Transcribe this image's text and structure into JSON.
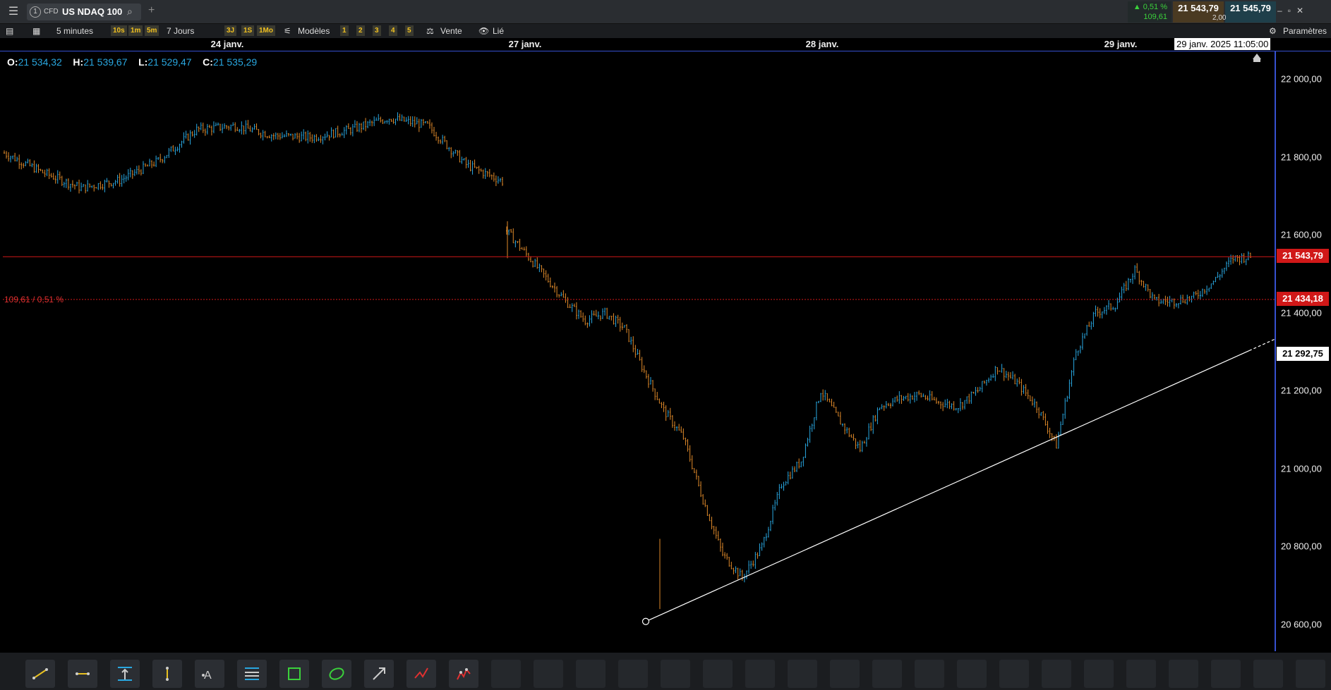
{
  "header": {
    "tab_number": "1",
    "tab_type": "CFD",
    "instrument": "US NDAQ 100",
    "change_pct": "▲ 0,51 %",
    "change_abs": "109,61",
    "bid": "21 543,79",
    "ask": "21 545,79",
    "spread": "2,00"
  },
  "toolbar": {
    "interval": "5 minutes",
    "quick_intervals": [
      "10s",
      "1m",
      "5m"
    ],
    "range": "7 Jours",
    "quick_ranges": [
      "3J",
      "1S",
      "1Mo"
    ],
    "templates": "Modèles",
    "layouts": [
      "1",
      "2",
      "3",
      "4",
      "5"
    ],
    "side": "Vente",
    "linked": "Lié",
    "settings": "Paramètres"
  },
  "ohlc": {
    "o_label": "O:",
    "o": "21 534,32",
    "h_label": "H:",
    "h": "21 539,67",
    "l_label": "L:",
    "l": "21 529,47",
    "c_label": "C:",
    "c": "21 535,29"
  },
  "date_labels": [
    "24 janv.",
    "27 janv.",
    "28 janv.",
    "29 janv."
  ],
  "cursor_date": "29 janv. 2025 11:05:00",
  "reference_label": "109,61 / 0,51 %",
  "price_ticks": [
    "22 000,00",
    "21 800,00",
    "21 600,00",
    "21 400,00",
    "21 200,00",
    "21 000,00",
    "20 800,00",
    "20 600,00"
  ],
  "price_tags": {
    "last": "21 543,79",
    "reference": "21 434,18",
    "trendline": "21 292,75"
  },
  "colors": {
    "up": "#29a7e0",
    "down": "#e08a2a",
    "last_line": "#d01818",
    "axis": "#3650d0"
  },
  "drawing_tools": [
    "trendline-icon",
    "horizontal-line-icon",
    "price-range-icon",
    "vertical-line-icon",
    "text-icon",
    "fibonacci-icon",
    "rectangle-icon",
    "ellipse-icon",
    "arrow-icon",
    "polyline-icon",
    "pattern-icon"
  ],
  "chart_data": {
    "type": "line",
    "title": "US NDAQ 100",
    "timeframe": "5 minutes",
    "x": [
      "24 janv.",
      "24 janv.",
      "24 janv.",
      "24 janv.",
      "24 janv.",
      "24 janv.",
      "24 janv.",
      "24 janv.",
      "24 janv.",
      "24 janv.",
      "24 janv.",
      "24 janv.",
      "24 janv.",
      "24 janv.",
      "27 janv.",
      "27 janv.",
      "27 janv.",
      "27 janv.",
      "27 janv.",
      "27 janv.",
      "27 janv.",
      "27 janv.",
      "27 janv.",
      "27 janv.",
      "27 janv.",
      "27 janv.",
      "27 janv.",
      "27 janv.",
      "27 janv.",
      "27 janv.",
      "28 janv.",
      "28 janv.",
      "28 janv.",
      "28 janv.",
      "28 janv.",
      "28 janv.",
      "28 janv.",
      "28 janv.",
      "28 janv.",
      "28 janv.",
      "28 janv.",
      "28 janv.",
      "28 janv.",
      "28 janv.",
      "28 janv.",
      "28 janv.",
      "29 janv.",
      "29 janv.",
      "29 janv.",
      "29 janv.",
      "29 janv.",
      "29 janv.",
      "29 janv."
    ],
    "close": [
      21810,
      21760,
      21720,
      21740,
      21790,
      21870,
      21880,
      21855,
      21850,
      21870,
      21900,
      21880,
      21780,
      21735,
      21610,
      21550,
      21490,
      21430,
      21380,
      21400,
      21360,
      21250,
      21150,
      21080,
      20920,
      20780,
      20720,
      20800,
      20960,
      21020,
      21200,
      21120,
      21050,
      21160,
      21180,
      21190,
      21170,
      21160,
      21200,
      21260,
      21220,
      21160,
      21060,
      21300,
      21400,
      21420,
      21510,
      21430,
      21430,
      21440,
      21480,
      21540,
      21544
    ],
    "ylim": [
      20540,
      22060
    ],
    "last_price": 21543.79,
    "reference_price": 21434.18,
    "trendline": {
      "start": [
        20720,
        20608
      ],
      "end_value": 21292.75
    }
  }
}
